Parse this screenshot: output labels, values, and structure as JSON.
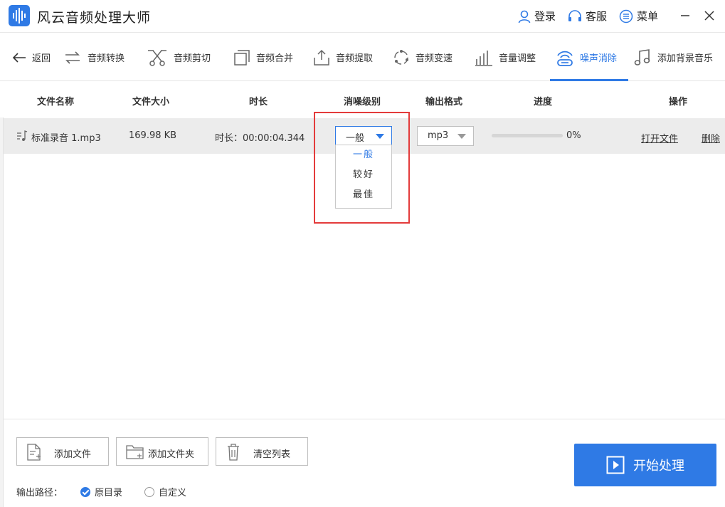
{
  "app": {
    "title": "风云音频处理大师"
  },
  "topbar": {
    "login": "登录",
    "service": "客服",
    "menu": "菜单"
  },
  "toolbar": {
    "back": "返回",
    "items": [
      "音频转换",
      "音频剪切",
      "音频合并",
      "音频提取",
      "音频变速",
      "音量调整",
      "噪声消除",
      "添加背景音乐"
    ],
    "active_index": 6
  },
  "table": {
    "headers": [
      "文件名称",
      "文件大小",
      "时长",
      "消噪级别",
      "输出格式",
      "进度",
      "操作"
    ],
    "rows": [
      {
        "file_name": "标准录音 1.mp3",
        "file_size": "169.98 KB",
        "duration": "时长：00:00:04.344",
        "noise_level": "一般",
        "format": "mp3",
        "progress_text": "0%",
        "progress": 0,
        "open_file": "打开文件",
        "delete": "删除"
      }
    ]
  },
  "noise_dropdown": {
    "options": [
      "一般",
      "较好",
      "最佳"
    ],
    "selected_index": 0
  },
  "bottom": {
    "add_file": "添加文件",
    "add_folder": "添加文件夹",
    "clear_list": "清空列表",
    "start": "开始处理",
    "output_path_label": "输出路径：",
    "radio_original": "原目录",
    "radio_custom": "自定义",
    "output_selected": "原目录"
  },
  "colors": {
    "accent": "#2f7ae5",
    "highlight": "#e33b3b"
  }
}
